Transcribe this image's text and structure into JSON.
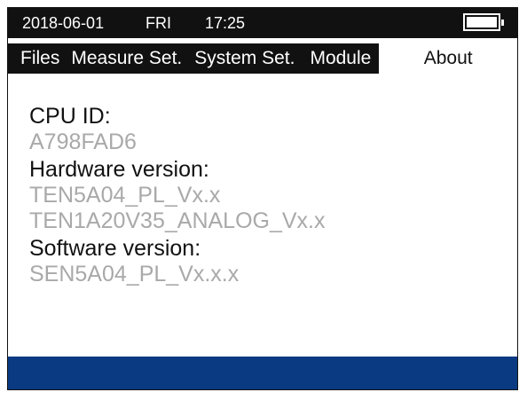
{
  "status": {
    "date": "2018-06-01",
    "day": "FRI",
    "time": "17:25",
    "battery_level": 1.0
  },
  "menu": {
    "items": [
      {
        "label": "Files",
        "active": false
      },
      {
        "label": "Measure Set.",
        "active": false
      },
      {
        "label": "System Set.",
        "active": false
      },
      {
        "label": "Module",
        "active": false
      },
      {
        "label": "About",
        "active": true
      }
    ]
  },
  "about": {
    "cpu_id_label": "CPU ID:",
    "cpu_id_value": "A798FAD6",
    "hardware_label": "Hardware version:",
    "hardware_values": [
      "TEN5A04_PL_Vx.x",
      "TEN1A20V35_ANALOG_Vx.x"
    ],
    "software_label": "Software version:",
    "software_value": "SEN5A04_PL_Vx.x.x"
  },
  "colors": {
    "bar_dark": "#111111",
    "footer_blue": "#0a3a82",
    "value_gray": "#a9a9a9"
  }
}
